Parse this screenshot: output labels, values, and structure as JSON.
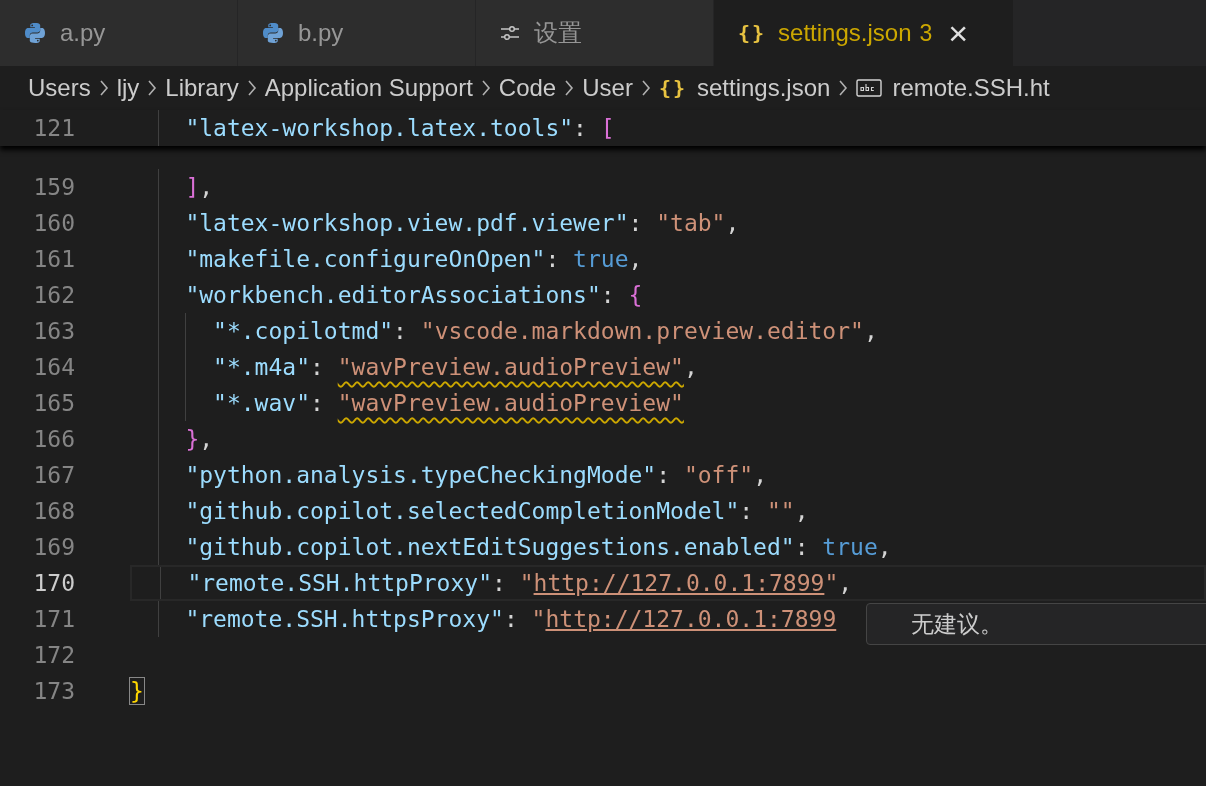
{
  "tabs": [
    {
      "kind": "python",
      "label": "a.py",
      "selected": false,
      "warning": false
    },
    {
      "kind": "python",
      "label": "b.py",
      "selected": false,
      "warning": false
    },
    {
      "kind": "settings",
      "label": "设置",
      "selected": false,
      "warning": false
    },
    {
      "kind": "json",
      "icon_text": "{}",
      "label": "settings.json",
      "badge": "3",
      "close": "×",
      "selected": true,
      "warning": true
    }
  ],
  "breadcrumbs": [
    {
      "label": "Users"
    },
    {
      "label": "ljy"
    },
    {
      "label": "Library"
    },
    {
      "label": "Application Support"
    },
    {
      "label": "Code"
    },
    {
      "label": "User"
    },
    {
      "kind": "json",
      "icon_text": "{}",
      "label": "settings.json"
    },
    {
      "kind": "string",
      "label": "remote.SSH.ht"
    }
  ],
  "sticky_line": {
    "number": "121",
    "kind": "member",
    "tokens": [
      {
        "kind": "key",
        "text": "\"latex-workshop.latex.tools\""
      },
      {
        "kind": "punct",
        "text": ": "
      },
      {
        "kind": "bracket",
        "text": "["
      }
    ]
  },
  "lines": [
    {
      "number": "159",
      "kind": "member",
      "current": false,
      "tokens": [
        {
          "kind": "bracket",
          "text": "]"
        },
        {
          "kind": "punct",
          "text": ","
        }
      ]
    },
    {
      "number": "160",
      "kind": "member",
      "current": false,
      "tokens": [
        {
          "kind": "key",
          "text": "\"latex-workshop.view.pdf.viewer\""
        },
        {
          "kind": "punct",
          "text": ": "
        },
        {
          "kind": "string",
          "text": "\"tab\""
        },
        {
          "kind": "punct",
          "text": ","
        }
      ]
    },
    {
      "number": "161",
      "kind": "member",
      "current": false,
      "tokens": [
        {
          "kind": "key",
          "text": "\"makefile.configureOnOpen\""
        },
        {
          "kind": "punct",
          "text": ": "
        },
        {
          "kind": "bool",
          "text": "true"
        },
        {
          "kind": "punct",
          "text": ","
        }
      ]
    },
    {
      "number": "162",
      "kind": "member",
      "current": false,
      "tokens": [
        {
          "kind": "key",
          "text": "\"workbench.editorAssociations\""
        },
        {
          "kind": "punct",
          "text": ": "
        },
        {
          "kind": "bracket",
          "text": "{"
        }
      ],
      "children": [
        {
          "number": "163",
          "current": false,
          "tokens": [
            {
              "kind": "key",
              "text": "\"*.copilotmd\""
            },
            {
              "kind": "punct",
              "text": ": "
            },
            {
              "kind": "string",
              "text": "\"vscode.markdown.preview.editor\""
            },
            {
              "kind": "punct",
              "text": ","
            }
          ]
        },
        {
          "number": "164",
          "current": false,
          "tokens": [
            {
              "kind": "key",
              "text": "\"*.m4a\""
            },
            {
              "kind": "punct",
              "text": ": "
            },
            {
              "kind": "string",
              "text": "\"wavPreview.audioPreview\"",
              "warning": true
            },
            {
              "kind": "punct",
              "text": ","
            }
          ]
        },
        {
          "number": "165",
          "current": false,
          "tokens": [
            {
              "kind": "key",
              "text": "\"*.wav\""
            },
            {
              "kind": "punct",
              "text": ": "
            },
            {
              "kind": "string",
              "text": "\"wavPreview.audioPreview\"",
              "warning": true
            }
          ]
        }
      ]
    },
    {
      "number": "166",
      "kind": "member",
      "current": false,
      "tokens": [
        {
          "kind": "bracket",
          "text": "}"
        },
        {
          "kind": "punct",
          "text": ","
        }
      ]
    },
    {
      "number": "167",
      "kind": "member",
      "current": false,
      "tokens": [
        {
          "kind": "key",
          "text": "\"python.analysis.typeCheckingMode\""
        },
        {
          "kind": "punct",
          "text": ": "
        },
        {
          "kind": "string",
          "text": "\"off\""
        },
        {
          "kind": "punct",
          "text": ","
        }
      ]
    },
    {
      "number": "168",
      "kind": "member",
      "current": false,
      "tokens": [
        {
          "kind": "key",
          "text": "\"github.copilot.selectedCompletionModel\""
        },
        {
          "kind": "punct",
          "text": ": "
        },
        {
          "kind": "string",
          "text": "\"\""
        },
        {
          "kind": "punct",
          "text": ","
        }
      ]
    },
    {
      "number": "169",
      "kind": "member",
      "current": false,
      "tokens": [
        {
          "kind": "key",
          "text": "\"github.copilot.nextEditSuggestions.enabled\""
        },
        {
          "kind": "punct",
          "text": ": "
        },
        {
          "kind": "bool",
          "text": "true"
        },
        {
          "kind": "punct",
          "text": ","
        }
      ]
    },
    {
      "number": "170",
      "kind": "member",
      "current": true,
      "tokens": [
        {
          "kind": "key",
          "text": "\"remote.SSH.httpProxy\""
        },
        {
          "kind": "punct",
          "text": ": "
        },
        {
          "kind": "string",
          "text": "\""
        },
        {
          "kind": "link",
          "text": "http://127.0.0.1:7899"
        },
        {
          "kind": "string",
          "text": "\""
        },
        {
          "kind": "punct",
          "text": ","
        }
      ]
    },
    {
      "number": "171",
      "kind": "member",
      "current": false,
      "tokens": [
        {
          "kind": "key",
          "text": "\"remote.SSH.httpsProxy\""
        },
        {
          "kind": "punct",
          "text": ": "
        },
        {
          "kind": "string",
          "text": "\""
        },
        {
          "kind": "link",
          "text": "http://127.0.0.1:7899"
        }
      ]
    },
    {
      "number": "172",
      "kind": "root",
      "current": false
    },
    {
      "number": "173",
      "kind": "root",
      "current": false,
      "tokens": [
        {
          "kind": "outer",
          "text": "}",
          "matched": true
        }
      ]
    }
  ],
  "suggest_widget": {
    "message": "无建议。"
  }
}
